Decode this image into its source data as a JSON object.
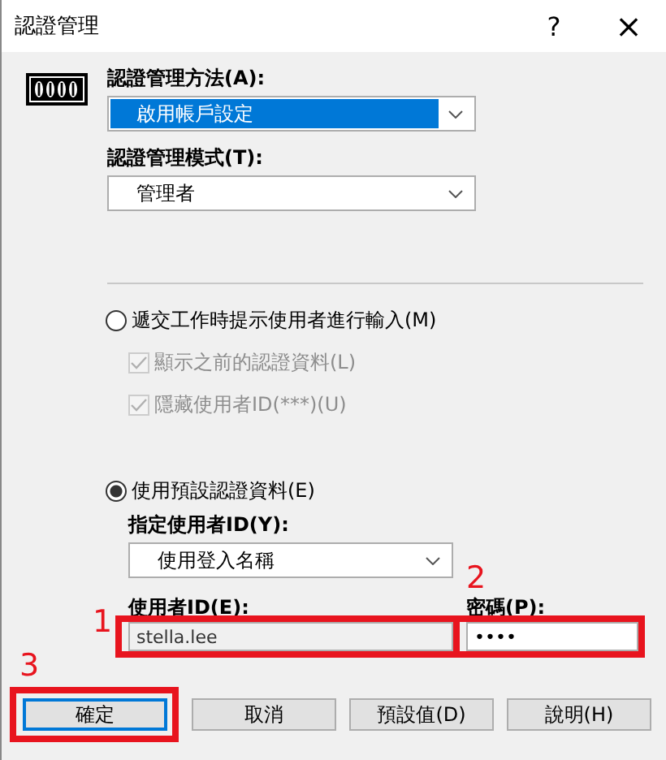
{
  "window": {
    "title": "認證管理",
    "help_button": "?",
    "close_button": "×"
  },
  "method": {
    "label": "認證管理方法(A):",
    "value": "啟用帳戶設定",
    "highlighted": true
  },
  "mode": {
    "label": "認證管理模式(T):",
    "value": "管理者",
    "highlighted": false
  },
  "options": [
    {
      "kind": "prompt",
      "label": "遞交工作時提示使用者進行輸入(M)",
      "selected": false,
      "checkboxes": [
        {
          "label": "顯示之前的認證資料(L)",
          "checked": true,
          "disabled": true
        },
        {
          "label": "隱藏使用者ID(***)(U)",
          "checked": true,
          "disabled": true
        }
      ]
    },
    {
      "kind": "default",
      "label": "使用預設認證資料(E)",
      "selected": true,
      "user_id_type": {
        "label": "指定使用者ID(Y):",
        "value": "使用登入名稱"
      },
      "user_id": {
        "label": "使用者ID(E):",
        "value": "stella.lee",
        "disabled": true,
        "callout": "1"
      },
      "password": {
        "label": "密碼(P):",
        "value": "••••",
        "callout": "2"
      }
    }
  ],
  "buttons": [
    {
      "label": "確定",
      "focused": true,
      "callout": "3"
    },
    {
      "label": "取消",
      "focused": false
    },
    {
      "label": "預設值(D)",
      "focused": false
    },
    {
      "label": "說明(H)",
      "focused": false
    }
  ]
}
